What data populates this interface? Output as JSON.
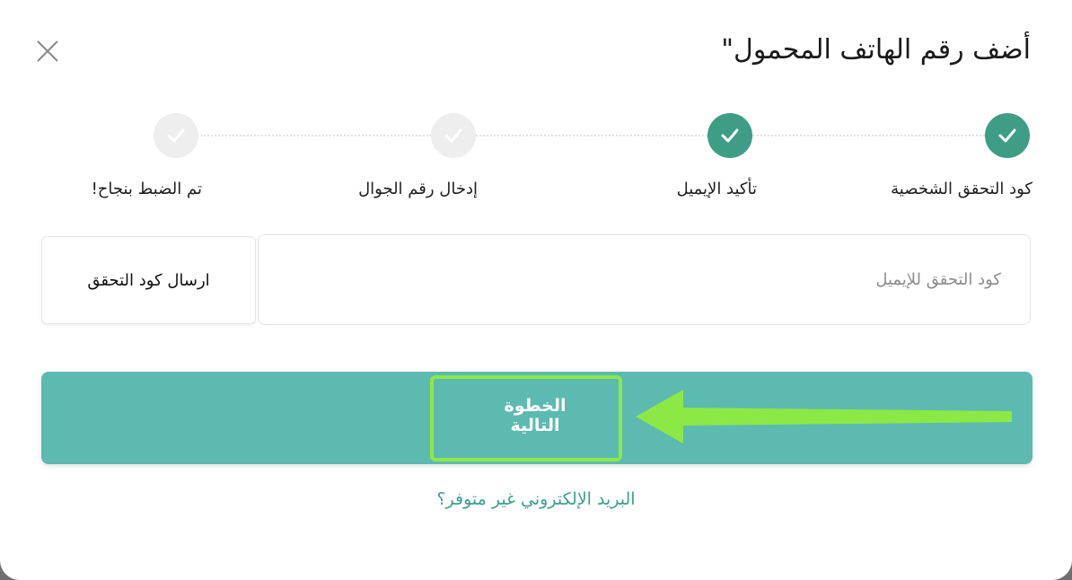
{
  "modal": {
    "title": "أضف رقم الهاتف المحمول\"",
    "close_icon": "close-icon"
  },
  "stepper": {
    "steps": [
      {
        "label": "كود التحقق الشخصية",
        "status": "complete",
        "icon": "check-icon"
      },
      {
        "label": "تأكيد الإيميل",
        "status": "complete",
        "icon": "check-icon"
      },
      {
        "label": "إدخال رقم الجوال",
        "status": "pending",
        "icon": "check-icon"
      },
      {
        "label": "تم الضبط بنجاح!",
        "status": "pending",
        "icon": "check-icon"
      }
    ]
  },
  "form": {
    "code_placeholder": "كود التحقق للإيميل",
    "code_value": "",
    "send_code_label": "ارسال كود التحقق"
  },
  "actions": {
    "next_label": "الخطوة التالية",
    "email_unavailable_link": "البريد الإلكتروني غير متوفر؟"
  },
  "colors": {
    "step_done": "#3f9d86",
    "step_pending": "#eeeeee",
    "primary_button": "#5cbab1",
    "link": "#3e9f8f",
    "annotation": "#8ce845"
  }
}
